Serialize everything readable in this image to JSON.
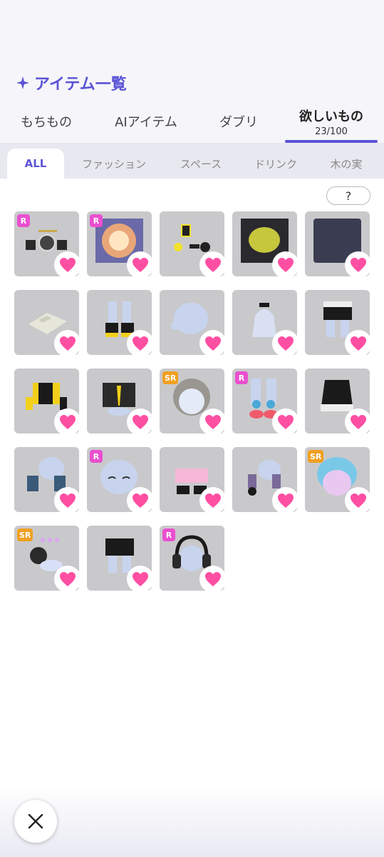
{
  "header": {
    "title": "アイテム一覧",
    "title_icon": "sparkle-icon"
  },
  "main_tabs": [
    {
      "label": "もちもの"
    },
    {
      "label": "AIアイテム"
    },
    {
      "label": "ダブリ"
    },
    {
      "label": "欲しいもの",
      "count": "23/100",
      "selected": true
    }
  ],
  "sub_tabs": [
    {
      "label": "ALL",
      "selected": true
    },
    {
      "label": "ファッション"
    },
    {
      "label": "スペース"
    },
    {
      "label": "ドリンク"
    },
    {
      "label": "木の実"
    }
  ],
  "help_label": "?",
  "items": [
    {
      "rarity": "R",
      "art": "drum-set"
    },
    {
      "rarity": "R",
      "art": "sun-glow"
    },
    {
      "rarity": "",
      "art": "yellow-stickers"
    },
    {
      "rarity": "",
      "art": "yellow-glow"
    },
    {
      "rarity": "",
      "art": "dark-night"
    },
    {
      "rarity": "",
      "art": "checker-rug"
    },
    {
      "rarity": "",
      "art": "black-yellow-boots"
    },
    {
      "rarity": "",
      "art": "plain-head"
    },
    {
      "rarity": "",
      "art": "choker"
    },
    {
      "rarity": "",
      "art": "black-shorts-belt"
    },
    {
      "rarity": "",
      "art": "yellow-jacket"
    },
    {
      "rarity": "",
      "art": "black-jacket-tie"
    },
    {
      "rarity": "SR",
      "art": "silver-hair"
    },
    {
      "rarity": "R",
      "art": "strawberry-socks"
    },
    {
      "rarity": "",
      "art": "black-camisole"
    },
    {
      "rarity": "",
      "art": "denim-sleeves"
    },
    {
      "rarity": "R",
      "art": "sleepy-face"
    },
    {
      "rarity": "",
      "art": "pink-socks"
    },
    {
      "rarity": "",
      "art": "purple-gloves"
    },
    {
      "rarity": "SR",
      "art": "cyan-hair"
    },
    {
      "rarity": "SR",
      "art": "black-cat-cloud"
    },
    {
      "rarity": "",
      "art": "black-shorts-zip"
    },
    {
      "rarity": "R",
      "art": "headphones"
    }
  ],
  "colors": {
    "accent": "#5b53d6",
    "heart": "#ff4fa3",
    "badge_r": "#ea4fd0",
    "badge_sr": "#f0a020"
  },
  "close_icon": "close-icon"
}
